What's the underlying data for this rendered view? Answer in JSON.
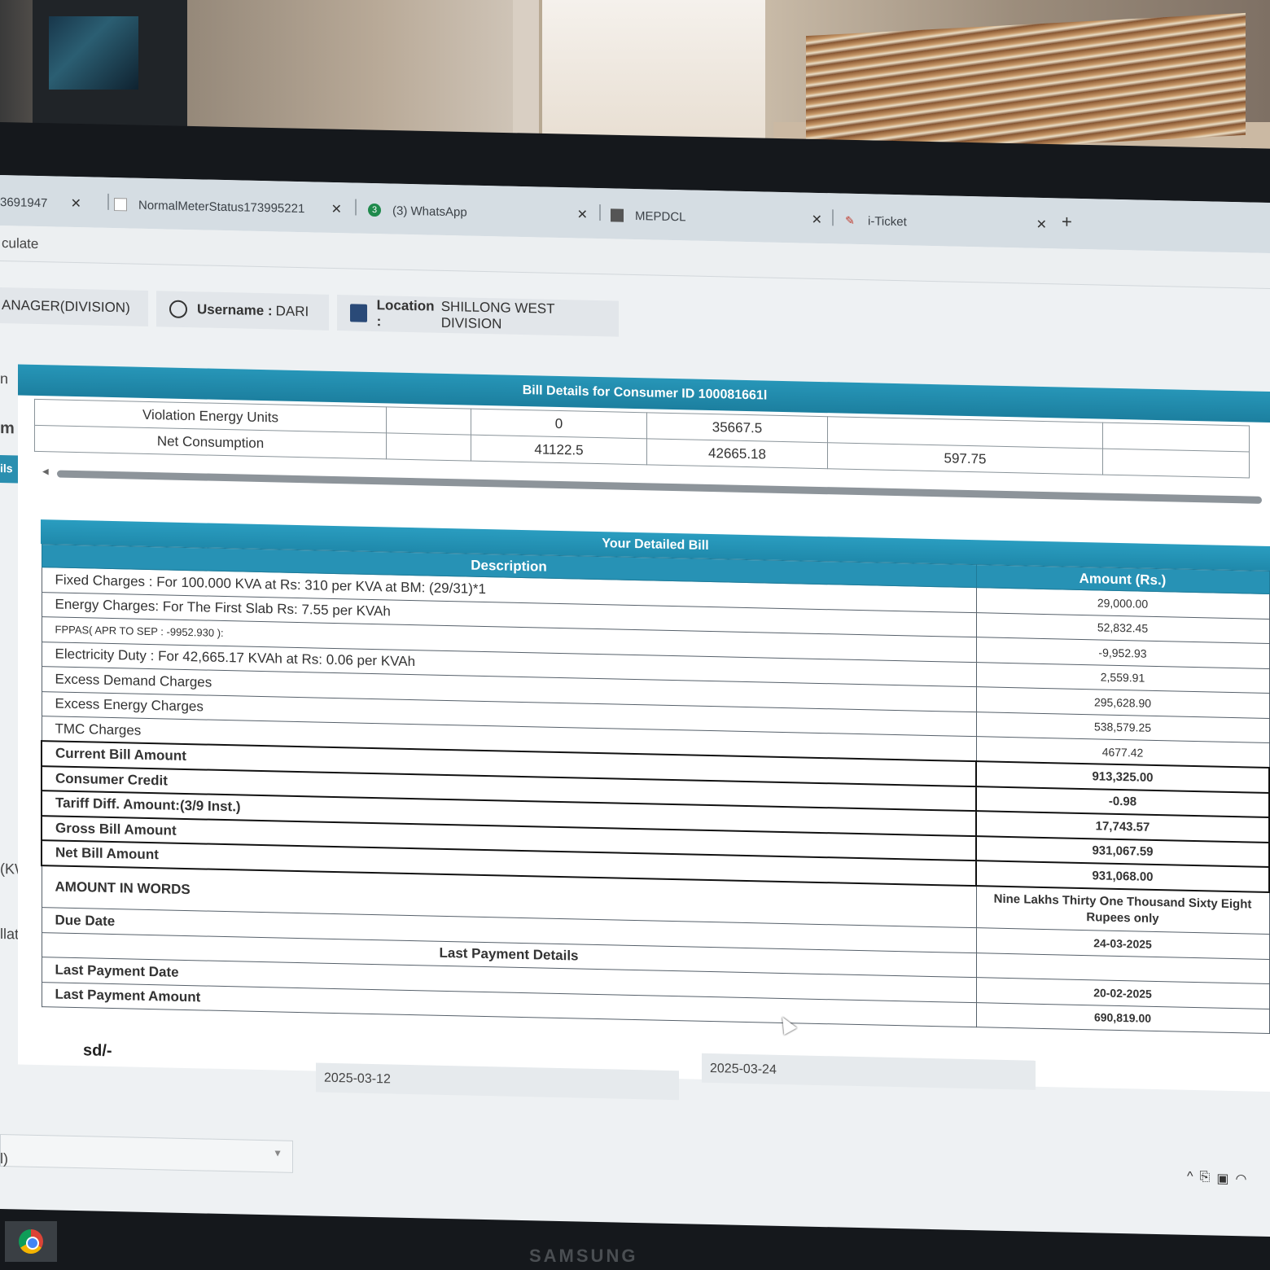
{
  "tabs": [
    {
      "label": "3691947",
      "icon": "page-icon"
    },
    {
      "label": "NormalMeterStatus173995221",
      "icon": "doc-icon"
    },
    {
      "label": "(3) WhatsApp",
      "icon": "whatsapp-icon"
    },
    {
      "label": "MEPDCL",
      "icon": "mepdcl-icon"
    },
    {
      "label": "i-Ticket",
      "icon": "ticket-icon"
    }
  ],
  "newtab_label": "+",
  "address_fragment": "culate",
  "header": {
    "role": "ANAGER(DIVISION)",
    "username_label": "Username :",
    "username": "DARI",
    "location_label": "Location :",
    "location": "SHILLONG WEST DIVISION"
  },
  "sidebar_fragments": [
    "n",
    "m",
    "ils",
    "(KW)",
    "llatio",
    "l)"
  ],
  "panel": {
    "title": "Bill Details for Consumer ID 100081661l",
    "consumption_rows": [
      {
        "label": "Violation Energy Units",
        "c1": "",
        "c2": "0",
        "c3": "35667.5",
        "c4": "",
        "c5": ""
      },
      {
        "label": "Net Consumption",
        "c1": "",
        "c2": "41122.5",
        "c3": "42665.18",
        "c4": "597.75",
        "c5": ""
      }
    ]
  },
  "bill": {
    "title": "Your Detailed Bill",
    "col_description": "Description",
    "col_amount": "Amount (Rs.)",
    "rows": [
      {
        "desc": "Fixed Charges : For 100.000 KVA at Rs: 310 per KVA at BM: (29/31)*1",
        "amount": "29,000.00"
      },
      {
        "desc": "Energy Charges: For The First Slab Rs: 7.55 per KVAh",
        "amount": "52,832.45"
      },
      {
        "desc": "FPPAS( APR TO SEP : -9952.930 ):",
        "amount": "-9,952.93"
      },
      {
        "desc": "Electricity Duty : For 42,665.17 KVAh at Rs: 0.06 per KVAh",
        "amount": "2,559.91"
      },
      {
        "desc": "Excess Demand Charges",
        "amount": "295,628.90"
      },
      {
        "desc": "Excess Energy Charges",
        "amount": "538,579.25"
      },
      {
        "desc": "TMC Charges",
        "amount": "4677.42"
      }
    ],
    "bold_rows": [
      {
        "desc": "Current Bill Amount",
        "amount": "913,325.00"
      },
      {
        "desc": "Consumer Credit",
        "amount": "-0.98"
      },
      {
        "desc": "Tariff Diff. Amount:(3/9 Inst.)",
        "amount": "17,743.57"
      },
      {
        "desc": "Gross Bill Amount",
        "amount": "931,067.59"
      },
      {
        "desc": "Net Bill Amount",
        "amount": "931,068.00"
      }
    ],
    "amount_in_words_label": "AMOUNT IN WORDS",
    "amount_in_words": "Nine Lakhs Thirty One Thousand Sixty Eight Rupees only",
    "due_date_label": "Due Date",
    "due_date": "24-03-2025",
    "last_payment_title": "Last Payment Details",
    "last_payment_date_label": "Last Payment Date",
    "last_payment_date": "20-02-2025",
    "last_payment_amount_label": "Last Payment Amount",
    "last_payment_amount": "690,819.00",
    "signature": "sd/-"
  },
  "date_fields": [
    "2025-03-12",
    "2025-03-24"
  ],
  "monitor_brand": "SAMSUNG"
}
